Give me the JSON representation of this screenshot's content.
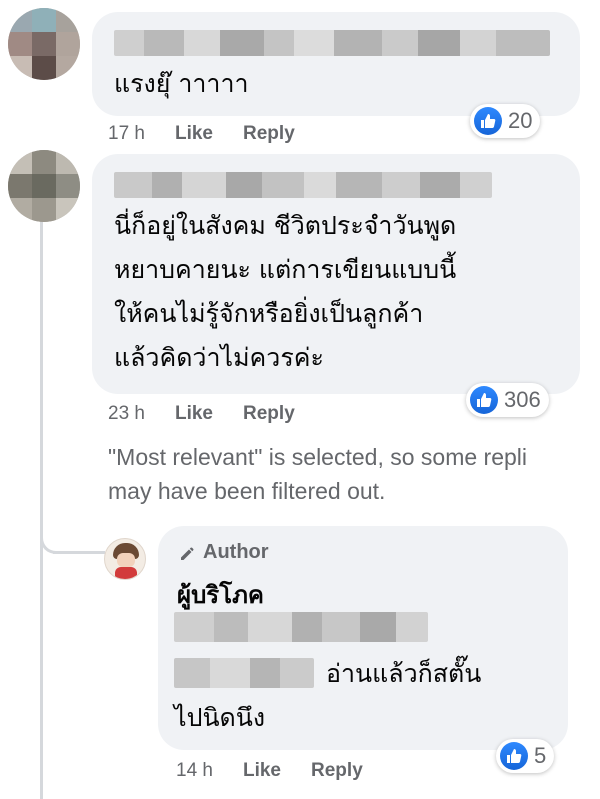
{
  "comments": [
    {
      "text_lines": [
        "แรงยุ๊ าาาาา"
      ],
      "time": "17 h",
      "like_label": "Like",
      "reply_label": "Reply",
      "reaction_count": "20"
    },
    {
      "text_lines": [
        "นี่ก็อยู่ในสังคม ชีวิตประจำวันพูด",
        "หยาบคายนะ แต่การเขียนแบบนี้",
        "ให้คนไม่รู้จักหรือยิ่งเป็นลูกค้า",
        "แล้วคิดว่าไม่ควรค่ะ"
      ],
      "time": "23 h",
      "like_label": "Like",
      "reply_label": "Reply",
      "reaction_count": "306"
    }
  ],
  "filter_note": {
    "line1": "\"Most relevant\" is selected, so some repli",
    "line2": "may have been filtered out."
  },
  "reply": {
    "badge": "Author",
    "name": "ผู้บริโภค",
    "text_tail_line": "อ่านแล้วก็สตั๊น",
    "text_last_line": "ไปนิดนึง",
    "time": "14 h",
    "like_label": "Like",
    "reply_label": "Reply",
    "reaction_count": "5"
  },
  "colors": {
    "bubble": "#f0f2f5",
    "secondary_text": "#65676b",
    "like_blue": "#1877f2",
    "thread_line": "#d5d8dc"
  },
  "icons": {
    "reaction": "thumbs-up-icon",
    "author": "pencil-icon"
  }
}
